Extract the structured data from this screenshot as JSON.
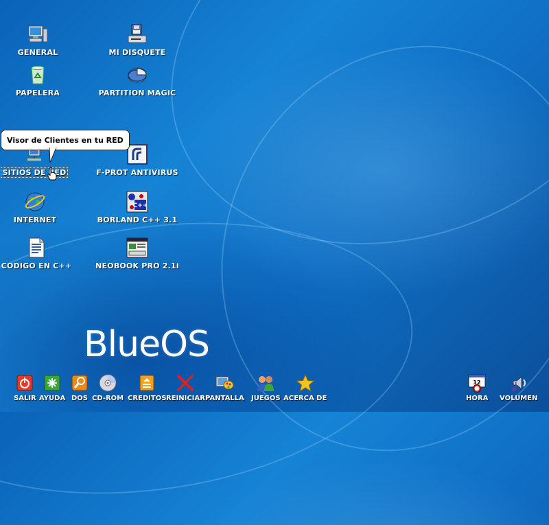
{
  "brand": {
    "logo_text": "BlueOS"
  },
  "desktop_icons": [
    {
      "label": "GENERAL",
      "icon": "computer-icon"
    },
    {
      "label": "MI DISQUETE",
      "icon": "floppy-drive-icon"
    },
    {
      "label": "PAPELERA",
      "icon": "recycle-bin-icon"
    },
    {
      "label": "PARTITION MAGIC",
      "icon": "partition-pie-icon"
    },
    {
      "label": "SITIOS DE RED",
      "icon": "network-places-icon"
    },
    {
      "label": "F-PROT ANTIVIRUS",
      "icon": "antivirus-icon"
    },
    {
      "label": "INTERNET",
      "icon": "globe-icon"
    },
    {
      "label": "BORLAND C++ 3.1",
      "icon": "cpp-compiler-icon"
    },
    {
      "label": "CODIGO EN C++",
      "icon": "document-icon"
    },
    {
      "label": "NEOBOOK PRO 2.1i",
      "icon": "neobook-window-icon"
    }
  ],
  "tooltip": {
    "text": "Visor de Clientes en tu RED"
  },
  "taskbar_left": [
    {
      "label": "SALIR",
      "icon": "power-icon",
      "color": "#e23b2c"
    },
    {
      "label": "AYUDA",
      "icon": "help-icon",
      "color": "#3aa53a"
    },
    {
      "label": "DOS",
      "icon": "dos-icon",
      "color": "#e88a1a"
    },
    {
      "label": "CD-ROM",
      "icon": "cd-icon",
      "color": "#d8d8e0"
    },
    {
      "label": "CREDITOS",
      "icon": "credits-icon",
      "color": "#f0a020"
    },
    {
      "label": "REINICIAR",
      "icon": "restart-x-icon",
      "color": "#e02020"
    },
    {
      "label": "PANTALLA",
      "icon": "display-icon",
      "color": "#5aa0e0"
    },
    {
      "label": "JUEGOS",
      "icon": "games-icon",
      "color": "#3060c0"
    },
    {
      "label": "ACERCA DE",
      "icon": "star-icon",
      "color": "#f7c21b"
    }
  ],
  "taskbar_right": [
    {
      "label": "HORA",
      "icon": "clock-icon"
    },
    {
      "label": "VOLUMEN",
      "icon": "volume-icon"
    }
  ]
}
